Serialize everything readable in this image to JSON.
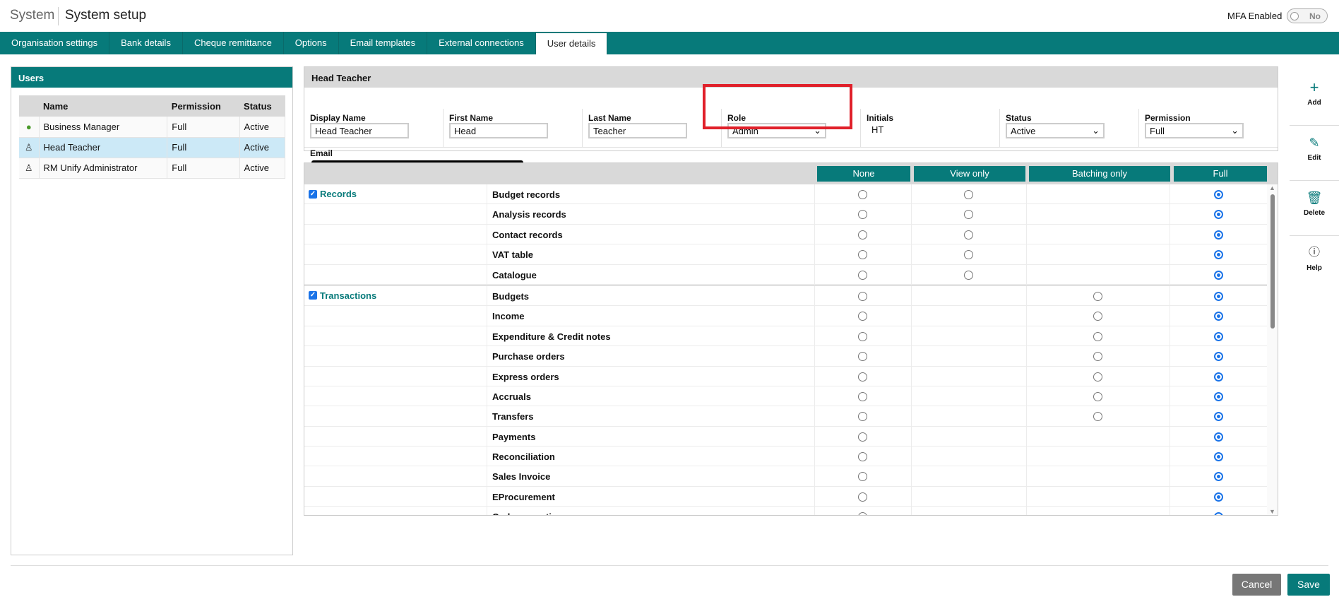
{
  "header": {
    "section": "System",
    "title": "System setup",
    "mfa_label": "MFA Enabled",
    "mfa_value": "No"
  },
  "tabs": [
    "Organisation settings",
    "Bank details",
    "Cheque remittance",
    "Options",
    "Email templates",
    "External connections",
    "User details"
  ],
  "active_tab": 6,
  "users": {
    "title": "Users",
    "columns": [
      "Name",
      "Permission",
      "Status"
    ],
    "rows": [
      {
        "name": "Business Manager",
        "permission": "Full",
        "status": "Active",
        "icon": "user-filled-green"
      },
      {
        "name": "Head Teacher",
        "permission": "Full",
        "status": "Active",
        "icon": "user-outline",
        "selected": true
      },
      {
        "name": "RM Unify Administrator",
        "permission": "Full",
        "status": "Active",
        "icon": "user-outline"
      }
    ]
  },
  "detail": {
    "title": "Head Teacher",
    "display_name_label": "Display Name",
    "display_name": "Head Teacher",
    "first_name_label": "First Name",
    "first_name": "Head",
    "last_name_label": "Last Name",
    "last_name": "Teacher",
    "role_label": "Role",
    "role": "Admin",
    "initials_label": "Initials",
    "initials": "HT",
    "status_label": "Status",
    "status": "Active",
    "permission_label": "Permission",
    "permission": "Full",
    "email_label": "Email"
  },
  "permissions": {
    "columns": [
      "None",
      "View only",
      "Batching only",
      "Full"
    ],
    "groups": [
      {
        "name": "Records",
        "checked": true,
        "items": [
          {
            "name": "Budget records",
            "options": [
              0,
              1
            ],
            "value": 3
          },
          {
            "name": "Analysis records",
            "options": [
              0,
              1
            ],
            "value": 3
          },
          {
            "name": "Contact records",
            "options": [
              0,
              1
            ],
            "value": 3
          },
          {
            "name": "VAT table",
            "options": [
              0,
              1
            ],
            "value": 3
          },
          {
            "name": "Catalogue",
            "options": [
              0,
              1
            ],
            "value": 3
          }
        ]
      },
      {
        "name": "Transactions",
        "checked": true,
        "items": [
          {
            "name": "Budgets",
            "options": [
              0,
              2
            ],
            "value": 3
          },
          {
            "name": "Income",
            "options": [
              0,
              2
            ],
            "value": 3
          },
          {
            "name": "Expenditure & Credit notes",
            "options": [
              0,
              2
            ],
            "value": 3
          },
          {
            "name": "Purchase orders",
            "options": [
              0,
              2
            ],
            "value": 3
          },
          {
            "name": "Express orders",
            "options": [
              0,
              2
            ],
            "value": 3
          },
          {
            "name": "Accruals",
            "options": [
              0,
              2
            ],
            "value": 3
          },
          {
            "name": "Transfers",
            "options": [
              0,
              2
            ],
            "value": 3
          },
          {
            "name": "Payments",
            "options": [
              0
            ],
            "value": 3
          },
          {
            "name": "Reconciliation",
            "options": [
              0
            ],
            "value": 3
          },
          {
            "name": "Sales Invoice",
            "options": [
              0
            ],
            "value": 3
          },
          {
            "name": "EProcurement",
            "options": [
              0
            ],
            "value": 3
          },
          {
            "name": "Code correction",
            "options": [
              0
            ],
            "value": 3
          }
        ]
      }
    ]
  },
  "sidebar": {
    "add": "Add",
    "edit": "Edit",
    "delete": "Delete",
    "help": "Help"
  },
  "footer": {
    "cancel": "Cancel",
    "save": "Save"
  },
  "colors": {
    "teal": "#077a7a",
    "highlight": "#e0202a",
    "radio": "#1a73e8"
  }
}
